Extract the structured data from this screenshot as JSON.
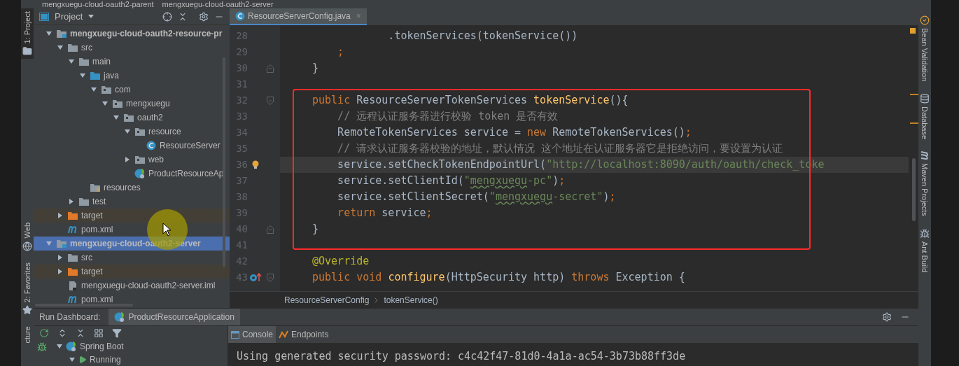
{
  "path_bar": [
    "mengxuegu-cloud-oauth2-parent",
    "mengxuegu-cloud-oauth2-server"
  ],
  "left_stripe": [
    {
      "label": "1: Project",
      "kind": "folder",
      "selected": true
    },
    {
      "label": "Web",
      "kind": "globe",
      "selected": false
    },
    {
      "label": "2: Favorites",
      "kind": "star",
      "selected": false
    },
    {
      "label": "cture",
      "kind": "none",
      "selected": false
    }
  ],
  "project": {
    "title": "Project",
    "tree": [
      {
        "label": "mengxuegu-cloud-oauth2-resource-pr",
        "kind": "module",
        "expanded": true,
        "selected": false,
        "children": [
          {
            "label": "src",
            "kind": "folder",
            "expanded": true,
            "selected": false,
            "children": [
              {
                "label": "main",
                "kind": "folder",
                "expanded": true,
                "selected": false,
                "children": [
                  {
                    "label": "java",
                    "kind": "source",
                    "expanded": true,
                    "selected": false,
                    "children": [
                      {
                        "label": "com",
                        "kind": "package",
                        "expanded": true,
                        "selected": false,
                        "children": [
                          {
                            "label": "mengxuegu",
                            "kind": "package",
                            "expanded": true,
                            "selected": false,
                            "children": [
                              {
                                "label": "oauth2",
                                "kind": "package",
                                "expanded": true,
                                "selected": false,
                                "children": [
                                  {
                                    "label": "resource",
                                    "kind": "package",
                                    "expanded": true,
                                    "selected": false,
                                    "children": [
                                      {
                                        "label": "ResourceServer",
                                        "kind": "class",
                                        "selected": false
                                      }
                                    ]
                                  },
                                  {
                                    "label": "web",
                                    "kind": "package",
                                    "expanded": false,
                                    "selected": false
                                  },
                                  {
                                    "label": "ProductResourceAp",
                                    "kind": "springapp",
                                    "selected": false
                                  }
                                ]
                              }
                            ]
                          }
                        ]
                      }
                    ]
                  },
                  {
                    "label": "resources",
                    "kind": "resources",
                    "selected": false
                  }
                ]
              },
              {
                "label": "test",
                "kind": "folder",
                "expanded": false,
                "selected": false
              }
            ]
          },
          {
            "label": "target",
            "kind": "excluded",
            "expanded": false,
            "selected": false
          },
          {
            "label": "pom.xml",
            "kind": "maven",
            "selected": false
          }
        ]
      },
      {
        "label": "mengxuegu-cloud-oauth2-server",
        "kind": "module",
        "expanded": true,
        "selected": true,
        "children": [
          {
            "label": "src",
            "kind": "folder",
            "expanded": false,
            "selected": false
          },
          {
            "label": "target",
            "kind": "excluded",
            "expanded": false,
            "selected": false
          },
          {
            "label": "mengxuegu-cloud-oauth2-server.iml",
            "kind": "iml",
            "selected": false
          },
          {
            "label": "pom.xml",
            "kind": "maven",
            "selected": false
          }
        ]
      }
    ]
  },
  "editor": {
    "tabs": [
      {
        "label": "ResourceServerConfig.java",
        "selected": true,
        "close": "×"
      }
    ],
    "lines": [
      {
        "number": "28",
        "current": false,
        "segments": [
          {
            "kind": "plain",
            "text": "            .tokenServices(tokenService())"
          }
        ]
      },
      {
        "number": "29",
        "current": false,
        "segments": [
          {
            "kind": "kw",
            "text": "    ;"
          }
        ]
      },
      {
        "number": "30",
        "current": false,
        "gutter_icons": [
          {
            "kind": "fold_end"
          }
        ],
        "segments": [
          {
            "kind": "plain",
            "text": "}"
          }
        ]
      },
      {
        "number": "31",
        "current": false
      },
      {
        "number": "32",
        "current": false,
        "gutter_icons": [
          {
            "kind": "fold_start"
          }
        ],
        "segments": [
          {
            "kind": "kw",
            "text": "public "
          },
          {
            "kind": "plain",
            "text": "ResourceServerTokenServices "
          },
          {
            "kind": "fn",
            "text": "tokenService"
          },
          {
            "kind": "plain",
            "text": "(){"
          }
        ]
      },
      {
        "number": "33",
        "current": false,
        "segments": [
          {
            "kind": "comment",
            "text": "    // 远程认证服务器进行校验 token 是否有效"
          }
        ]
      },
      {
        "number": "34",
        "current": false,
        "segments": [
          {
            "kind": "plain",
            "text": "    RemoteTokenServices service = "
          },
          {
            "kind": "kw",
            "text": "new "
          },
          {
            "kind": "plain",
            "text": "RemoteTokenServices()"
          },
          {
            "kind": "kw",
            "text": ";"
          }
        ]
      },
      {
        "number": "35",
        "current": false,
        "segments": [
          {
            "kind": "comment",
            "text": "    // 请求认证服务器校验的地址，默认情况 这个地址在认证服务器它是拒绝访问，要设置为认证"
          }
        ]
      },
      {
        "number": "36",
        "current": true,
        "gutter_icons": [
          {
            "kind": "bulb"
          }
        ],
        "segments": [
          {
            "kind": "plain",
            "text": "    service.setCheckTokenEndpointUrl("
          },
          {
            "kind": "str",
            "text": "\"http://localhost:8090/auth/oauth/check_toke"
          }
        ]
      },
      {
        "number": "37",
        "current": false,
        "segments": [
          {
            "kind": "plain",
            "text": "    service.setClientId("
          },
          {
            "kind": "str",
            "text": "\""
          },
          {
            "kind": "typo",
            "text": "mengxuegu"
          },
          {
            "kind": "str",
            "text": "-pc\""
          },
          {
            "kind": "plain",
            "text": ")"
          },
          {
            "kind": "kw",
            "text": ";"
          }
        ]
      },
      {
        "number": "38",
        "current": false,
        "segments": [
          {
            "kind": "plain",
            "text": "    service.setClientSecret("
          },
          {
            "kind": "str",
            "text": "\""
          },
          {
            "kind": "typo",
            "text": "mengxuegu"
          },
          {
            "kind": "str",
            "text": "-secret\""
          },
          {
            "kind": "plain",
            "text": ")"
          },
          {
            "kind": "kw",
            "text": ";"
          }
        ]
      },
      {
        "number": "39",
        "current": false,
        "segments": [
          {
            "kind": "kw",
            "text": "    return "
          },
          {
            "kind": "plain",
            "text": "service"
          },
          {
            "kind": "kw",
            "text": ";"
          }
        ]
      },
      {
        "number": "40",
        "current": false,
        "gutter_icons": [
          {
            "kind": "fold_end"
          }
        ],
        "segments": [
          {
            "kind": "plain",
            "text": "}"
          }
        ]
      },
      {
        "number": "41",
        "current": false
      },
      {
        "number": "42",
        "current": false,
        "segments": [
          {
            "kind": "annot",
            "text": "@Override"
          }
        ]
      },
      {
        "number": "43",
        "current": false,
        "gutter_icons": [
          {
            "kind": "override"
          },
          {
            "kind": "fold_start"
          }
        ],
        "segments": [
          {
            "kind": "kw",
            "text": "public void "
          },
          {
            "kind": "fn",
            "text": "configure"
          },
          {
            "kind": "plain",
            "text": "(HttpSecurity http) "
          },
          {
            "kind": "kw",
            "text": "throws "
          },
          {
            "kind": "plain",
            "text": "Exception {"
          }
        ]
      }
    ],
    "breadcrumb": [
      "ResourceServerConfig",
      "tokenService()"
    ]
  },
  "right_stripe": [
    {
      "label": "Bean Validation",
      "kind": "check"
    },
    {
      "label": "Database",
      "kind": "database"
    },
    {
      "label": "Maven Projects",
      "kind": "maven"
    },
    {
      "label": "Ant Build",
      "kind": "ant"
    }
  ],
  "run_dashboard": {
    "title": "Run Dashboard:",
    "tabs": [
      {
        "label": "ProductResourceApplication",
        "selected": true
      }
    ],
    "tree": [
      {
        "label": "Spring Boot",
        "kind": "group",
        "expanded": true,
        "children": [
          {
            "label": "Running",
            "kind": "running",
            "expanded": true
          }
        ]
      }
    ],
    "console_tabs": [
      {
        "label": "Console",
        "kind": "console",
        "selected": true
      },
      {
        "label": "Endpoints",
        "kind": "endpoints",
        "selected": false
      }
    ],
    "output": [
      "Using generated security password: c4c42f47-81d0-4a1a-ac54-3b73b88ff3de"
    ]
  }
}
